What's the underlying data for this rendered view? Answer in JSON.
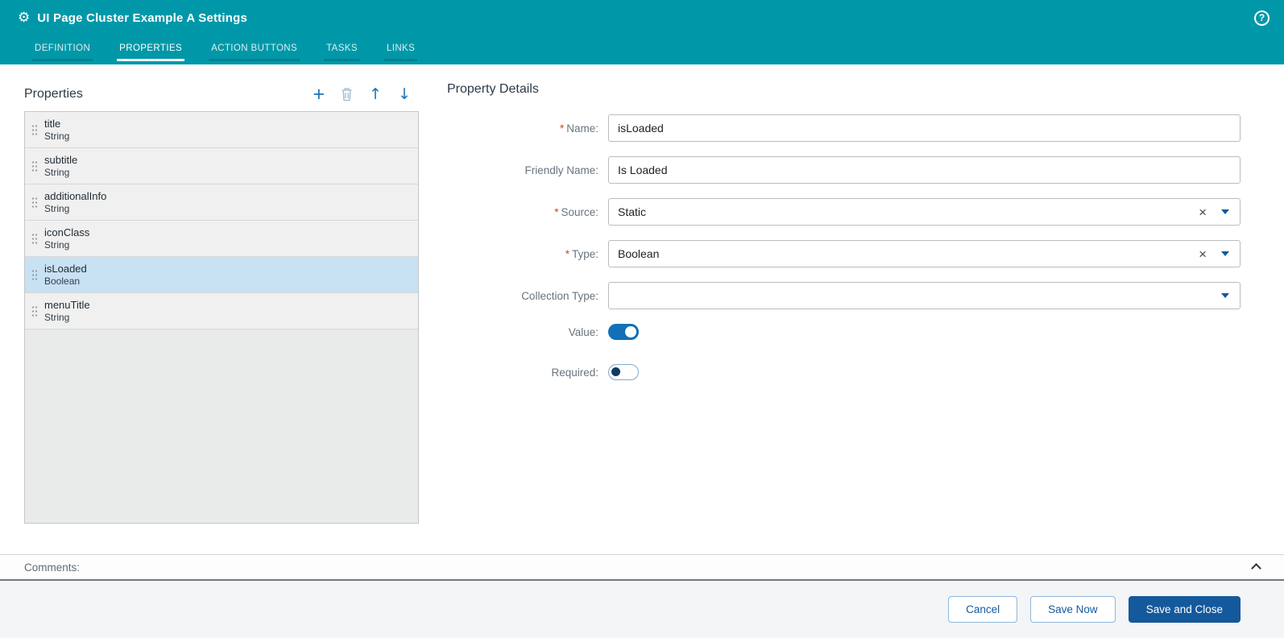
{
  "header": {
    "title": "UI Page Cluster Example A Settings",
    "tabs": [
      {
        "label": "DEFINITION",
        "active": false
      },
      {
        "label": "PROPERTIES",
        "active": true
      },
      {
        "label": "ACTION BUTTONS",
        "active": false
      },
      {
        "label": "TASKS",
        "active": false
      },
      {
        "label": "LINKS",
        "active": false
      }
    ]
  },
  "icons": {
    "gear": "⚙",
    "help": "?",
    "add": "+",
    "move_up": "↑",
    "move_down": "↓",
    "clear": "×"
  },
  "properties_panel": {
    "title": "Properties",
    "items": [
      {
        "name": "title",
        "type": "String",
        "selected": false
      },
      {
        "name": "subtitle",
        "type": "String",
        "selected": false
      },
      {
        "name": "additionalInfo",
        "type": "String",
        "selected": false
      },
      {
        "name": "iconClass",
        "type": "String",
        "selected": false
      },
      {
        "name": "isLoaded",
        "type": "Boolean",
        "selected": true
      },
      {
        "name": "menuTitle",
        "type": "String",
        "selected": false
      }
    ]
  },
  "details_panel": {
    "title": "Property Details",
    "required_marker": "*",
    "fields": {
      "name": {
        "label": "Name:",
        "value": "isLoaded",
        "required": true
      },
      "friendly_name": {
        "label": "Friendly Name:",
        "value": "Is Loaded",
        "required": false
      },
      "source": {
        "label": "Source:",
        "value": "Static",
        "required": true
      },
      "type": {
        "label": "Type:",
        "value": "Boolean",
        "required": true
      },
      "collection_type": {
        "label": "Collection Type:",
        "value": "",
        "required": false
      },
      "value": {
        "label": "Value:",
        "on": true
      },
      "required": {
        "label": "Required:",
        "on": false
      }
    }
  },
  "comments": {
    "label": "Comments:"
  },
  "footer": {
    "cancel_label": "Cancel",
    "save_now_label": "Save Now",
    "save_and_close_label": "Save and Close"
  },
  "colors": {
    "header_bg": "#0098a8",
    "accent": "#1a73b7",
    "primary_button": "#14599c",
    "selected_row": "#c8e1f3",
    "required_asterisk": "#cf4a21",
    "toggle_on": "#1170b8"
  }
}
